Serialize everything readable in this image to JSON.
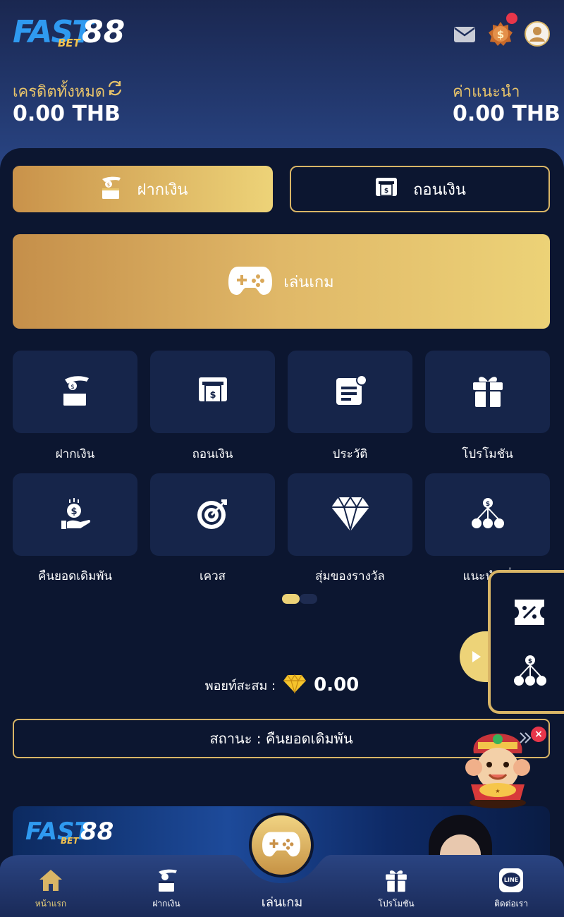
{
  "app": {
    "logo": {
      "word1": "FAST",
      "word2": "88",
      "sub": "BET"
    }
  },
  "header": {
    "balance_label": "เครดิตทั้งหมด",
    "balance_value": "0.00 THB",
    "commission_label": "ค่าแนะนำ",
    "commission_value": "0.00 THB",
    "icons": [
      "mail-icon",
      "coin-medal-icon",
      "user-avatar-icon"
    ]
  },
  "actions": {
    "deposit": "ฝากเงิน",
    "withdraw": "ถอนเงิน",
    "play": "เล่นเกม"
  },
  "menu": {
    "items": [
      {
        "label": "ฝากเงิน",
        "icon": "deposit-icon"
      },
      {
        "label": "ถอนเงิน",
        "icon": "withdraw-icon"
      },
      {
        "label": "ประวัติ",
        "icon": "history-icon"
      },
      {
        "label": "โปรโมชัน",
        "icon": "gift-icon"
      },
      {
        "label": "คืนยอดเดิมพัน",
        "icon": "cashback-icon"
      },
      {
        "label": "เควส",
        "icon": "target-icon"
      },
      {
        "label": "สุ่มของรางวัล",
        "icon": "diamond-icon"
      },
      {
        "label": "แนะนำเพื่",
        "icon": "referral-icon"
      }
    ],
    "page_indicator": {
      "pages": 2,
      "current": 1
    }
  },
  "points": {
    "label": "พอยท์สะสม :",
    "value": "0.00"
  },
  "status": {
    "text": "สถานะ : คืนยอดเดิมพัน"
  },
  "banner": {
    "logo": {
      "word1": "FAST",
      "word2": "88",
      "sub": "BET"
    }
  },
  "bottom_nav": {
    "items": [
      {
        "label": "หน้าแรก",
        "icon": "home-icon",
        "active": true
      },
      {
        "label": "ฝากเงิน",
        "icon": "deposit-icon"
      },
      {
        "label": "เล่นเกม",
        "icon": "gamepad-icon"
      },
      {
        "label": "โปรโมชัน",
        "icon": "gift-icon"
      },
      {
        "label": "ติดต่อเรา",
        "icon": "line-icon"
      }
    ]
  },
  "colors": {
    "background": "#0c1630",
    "header_top": "#1a2750",
    "header_bottom": "#2a4788",
    "tile": "#16254a",
    "gold_start": "#c9924a",
    "gold_end": "#edd378",
    "gold_border": "#d9b566",
    "label_gold": "#e8c46a",
    "notification_red": "#e8364a"
  }
}
